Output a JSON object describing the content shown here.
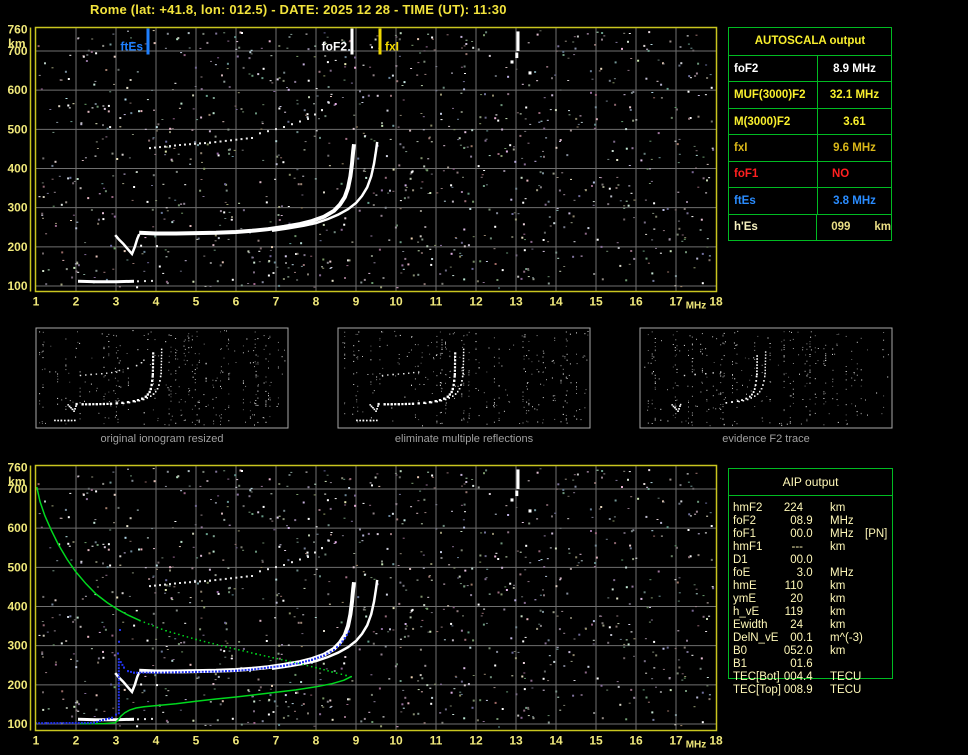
{
  "title": "Rome (lat: +41.8, lon: 012.5) - DATE: 2025 12 28 - TIME (UT): 11:30",
  "colors": {
    "background": "#000000",
    "axis_border": "#c9c51f",
    "tick_label": "#f0e87a",
    "grid": "#6f6f6f",
    "echo_white": "#ffffff",
    "echo_dim": "#e0e0e0",
    "profile_green": "#00d81e",
    "restored_blue": "#2233ee",
    "marker_blue": "#1e7fff",
    "marker_white": "#ffffff",
    "marker_yellow": "#f0d800",
    "table_border_green": "#00bb22",
    "autoscala_header_yellow": "#f8ef2d",
    "aip_text": "#fff8b8",
    "caption_gray": "#a0a0a0"
  },
  "axis": {
    "x_unit": "MHz",
    "y_unit": "km",
    "xticks": [
      1,
      2,
      3,
      4,
      5,
      6,
      7,
      8,
      9,
      10,
      11,
      12,
      13,
      14,
      15,
      16,
      17,
      18
    ],
    "yticks": [
      760,
      700,
      600,
      500,
      400,
      300,
      200,
      100
    ]
  },
  "autoscala_table": {
    "title": "AUTOSCALA output",
    "rows": [
      {
        "label": "foF2",
        "value": "8.9 MHz",
        "color": "#ffffff"
      },
      {
        "label": "MUF(3000)F2",
        "value": "32.1 MHz",
        "color": "#f8ef2d"
      },
      {
        "label": "M(3000)F2",
        "value": "3.61",
        "color": "#f8ef2d"
      },
      {
        "label": "fxI",
        "value": "9.6 MHz",
        "color": "#d9b718"
      },
      {
        "label": "foF1",
        "value": "NO",
        "color": "#ff2020",
        "align": "left"
      },
      {
        "label": "ftEs",
        "value": "3.8 MHz",
        "color": "#2a8cff"
      },
      {
        "label": "h'Es",
        "value": "099",
        "unit": "km",
        "color": "#f7f2c0",
        "value_color": "#e9dd85",
        "align": "left"
      }
    ]
  },
  "aip_table": {
    "title": "AIP output",
    "rows": [
      {
        "label": "hmF2",
        "value": "224",
        "unit": "km"
      },
      {
        "label": "foF2",
        "value": "08.9",
        "unit": "MHz"
      },
      {
        "label": "foF1",
        "value": "00.0",
        "unit": "MHz",
        "extra": "[PN]"
      },
      {
        "label": "hmF1",
        "value": "---",
        "unit": "km"
      },
      {
        "label": "D1",
        "value": "00.0",
        "unit": ""
      },
      {
        "label": "foE",
        "value": "3.0",
        "unit": "MHz"
      },
      {
        "label": "hmE",
        "value": "110",
        "unit": "km"
      },
      {
        "label": "ymE",
        "value": "20",
        "unit": "km"
      },
      {
        "label": "h_vE",
        "value": "119",
        "unit": "km"
      },
      {
        "label": "Ewidth",
        "value": "24",
        "unit": "km"
      },
      {
        "label": "DelN_vE",
        "value": "00.1",
        "unit": "m^(-3)"
      },
      {
        "label": "B0",
        "value": "052.0",
        "unit": "km"
      },
      {
        "label": "B1",
        "value": "01.6",
        "unit": ""
      },
      {
        "label": "TEC[Bot]",
        "value": "004.4",
        "unit": "TECU"
      },
      {
        "label": "TEC[Top]",
        "value": "008.9",
        "unit": "TECU"
      }
    ]
  },
  "thumbnails": [
    {
      "caption": "original ionogram resized"
    },
    {
      "caption": "eliminate multiple reflections"
    },
    {
      "caption": "evidence F2 trace"
    }
  ],
  "chart_data": [
    {
      "type": "scatter",
      "title": "ionogram with AUTOSCALA markers",
      "xlabel": "MHz",
      "ylabel": "km",
      "xlim": [
        1,
        18
      ],
      "ylim": [
        100,
        760
      ],
      "grid": true,
      "markers": [
        {
          "label": "ftEs",
          "freq": 3.8,
          "color": "#1e7fff",
          "side": "left"
        },
        {
          "label": "foF2",
          "freq": 8.9,
          "color": "#ffffff",
          "side": "left"
        },
        {
          "label": "fxI",
          "freq": 9.6,
          "color": "#f0d800",
          "side": "right"
        }
      ],
      "series": [
        {
          "name": "Es-trace",
          "style": "line",
          "width": 3,
          "color": "#ffffff",
          "points": [
            [
              2.05,
              112
            ],
            [
              2.5,
              111
            ],
            [
              3.0,
              111
            ],
            [
              3.45,
              112
            ]
          ]
        },
        {
          "name": "Es-trace-ext",
          "style": "dotted",
          "size": 2,
          "step": 6,
          "color": "#e0e0e0",
          "points": [
            [
              3.55,
              112
            ],
            [
              3.9,
              113
            ]
          ]
        },
        {
          "name": "F-cusp-dip",
          "style": "line",
          "width": 2.5,
          "color": "#ffffff",
          "points": [
            [
              2.98,
              230
            ],
            [
              3.08,
              218
            ],
            [
              3.18,
              208
            ],
            [
              3.28,
              196
            ],
            [
              3.4,
              182
            ],
            [
              3.47,
              200
            ],
            [
              3.53,
              220
            ],
            [
              3.58,
              232
            ]
          ]
        },
        {
          "name": "F2-trace-ordinary",
          "style": "line",
          "width": 4,
          "color": "#ffffff",
          "points": [
            [
              3.58,
              236
            ],
            [
              4.0,
              234
            ],
            [
              4.5,
              234
            ],
            [
              5.0,
              235
            ],
            [
              5.5,
              236
            ],
            [
              6.0,
              238
            ],
            [
              6.4,
              241
            ],
            [
              6.8,
              245
            ],
            [
              7.2,
              251
            ],
            [
              7.6,
              258
            ],
            [
              7.9,
              266
            ],
            [
              8.2,
              277
            ],
            [
              8.45,
              292
            ],
            [
              8.6,
              308
            ],
            [
              8.72,
              327
            ],
            [
              8.8,
              350
            ],
            [
              8.86,
              380
            ],
            [
              8.9,
              412
            ],
            [
              8.93,
              445
            ],
            [
              8.95,
              462
            ]
          ]
        },
        {
          "name": "F2-trace-extraordinary",
          "style": "line",
          "width": 2.5,
          "color": "#ffffff",
          "points": [
            [
              6.9,
              241
            ],
            [
              7.3,
              247
            ],
            [
              7.7,
              254
            ],
            [
              8.0,
              261
            ],
            [
              8.3,
              271
            ],
            [
              8.55,
              282
            ],
            [
              8.8,
              296
            ],
            [
              9.0,
              312
            ],
            [
              9.15,
              330
            ],
            [
              9.28,
              352
            ],
            [
              9.38,
              380
            ],
            [
              9.45,
              412
            ],
            [
              9.5,
              445
            ],
            [
              9.53,
              468
            ]
          ]
        },
        {
          "name": "second-hop-flat",
          "style": "dotted",
          "size": 2,
          "step": 5,
          "color": "#e8e8e8",
          "points": [
            [
              3.85,
              452
            ],
            [
              4.6,
              460
            ],
            [
              5.35,
              466
            ],
            [
              6.4,
              478
            ]
          ]
        },
        {
          "name": "second-hop-rise",
          "style": "dotted",
          "size": 2,
          "step": 7,
          "color": "#e8e8e8",
          "points": [
            [
              6.6,
              490
            ],
            [
              7.2,
              506
            ],
            [
              7.8,
              527
            ],
            [
              8.15,
              549
            ],
            [
              8.32,
              568
            ]
          ]
        },
        {
          "name": "interference-streaks",
          "style": "vdash",
          "width": 3,
          "color": "#ffffff",
          "points": [
            [
              13.05,
              750,
              700
            ],
            [
              13.02,
              696,
              682
            ],
            [
              12.9,
              676,
              668
            ],
            [
              13.35,
              648,
              640
            ]
          ]
        }
      ]
    },
    {
      "type": "scatter",
      "title": "ionogram with AIP restored profile",
      "xlabel": "MHz",
      "ylabel": "km",
      "xlim": [
        1,
        18
      ],
      "ylim": [
        100,
        760
      ],
      "grid": true,
      "echoes": "same-as-top-panel",
      "series": [
        {
          "name": "profile-green-topside",
          "style": "line",
          "width": 1.5,
          "color": "#00d81e",
          "points": [
            [
              1.02,
              705
            ],
            [
              1.1,
              668
            ],
            [
              1.22,
              632
            ],
            [
              1.38,
              595
            ],
            [
              1.56,
              558
            ],
            [
              1.78,
              520
            ],
            [
              2.0,
              488
            ],
            [
              2.25,
              458
            ],
            [
              2.5,
              432
            ],
            [
              2.78,
              410
            ],
            [
              3.05,
              392
            ],
            [
              3.3,
              378
            ],
            [
              3.6,
              364
            ]
          ]
        },
        {
          "name": "profile-green-dotted",
          "style": "dotted",
          "size": 1.5,
          "step": 4,
          "color": "#00d81e",
          "points": [
            [
              3.6,
              364
            ],
            [
              4.25,
              338
            ],
            [
              5.0,
              316
            ],
            [
              5.75,
              297
            ],
            [
              6.5,
              279
            ],
            [
              7.25,
              262
            ],
            [
              8.0,
              244
            ],
            [
              8.4,
              233
            ],
            [
              8.75,
              224
            ],
            [
              8.88,
              221
            ]
          ]
        },
        {
          "name": "profile-green-bottomside",
          "style": "line",
          "width": 1.5,
          "color": "#00d81e",
          "points": [
            [
              8.88,
              221
            ],
            [
              8.7,
              212
            ],
            [
              8.4,
              203
            ],
            [
              8.0,
              195
            ],
            [
              7.5,
              187
            ],
            [
              7.0,
              181
            ],
            [
              6.5,
              175
            ],
            [
              6.0,
              169
            ],
            [
              5.5,
              164
            ],
            [
              5.0,
              158
            ],
            [
              4.5,
              152
            ],
            [
              4.0,
              147
            ],
            [
              3.7,
              144
            ],
            [
              3.5,
              141
            ],
            [
              3.35,
              136
            ],
            [
              3.22,
              129
            ],
            [
              3.12,
              120
            ],
            [
              3.05,
              110
            ],
            [
              2.98,
              103
            ],
            [
              2.7,
              101
            ],
            [
              2.4,
              101
            ],
            [
              2.1,
              101
            ]
          ]
        },
        {
          "name": "restored-blue-E",
          "style": "dotted",
          "size": 2,
          "step": 3,
          "color": "#2233ee",
          "points": [
            [
              1.0,
              102
            ],
            [
              2.45,
              103
            ],
            [
              2.6,
              108
            ],
            [
              2.75,
              112
            ],
            [
              2.9,
              116
            ],
            [
              3.0,
              124
            ]
          ]
        },
        {
          "name": "restored-blue-column",
          "style": "vdots",
          "size": 2,
          "step": 3,
          "color": "#2233ee",
          "points": [
            [
              3.07,
              130
            ],
            [
              3.07,
              268
            ]
          ]
        },
        {
          "name": "restored-blue-sparse",
          "style": "dotted",
          "size": 2,
          "step": 9,
          "color": "#2233ee",
          "points": [
            [
              3.05,
              280
            ],
            [
              3.1,
              340
            ]
          ]
        },
        {
          "name": "restored-blue-F-trace",
          "style": "dotted",
          "size": 2,
          "step": 3,
          "color": "#2233ee",
          "points": [
            [
              3.12,
              258
            ],
            [
              3.2,
              244
            ],
            [
              3.3,
              235
            ],
            [
              3.45,
              231
            ],
            [
              4.0,
              231
            ],
            [
              4.5,
              232
            ],
            [
              5.0,
              233
            ],
            [
              5.5,
              234
            ],
            [
              6.0,
              236
            ],
            [
              6.4,
              239
            ],
            [
              6.8,
              244
            ],
            [
              7.2,
              249
            ],
            [
              7.6,
              256
            ],
            [
              7.9,
              264
            ],
            [
              8.2,
              275
            ],
            [
              8.45,
              289
            ],
            [
              8.6,
              303
            ],
            [
              8.72,
              319
            ],
            [
              8.82,
              336
            ]
          ]
        }
      ]
    }
  ]
}
